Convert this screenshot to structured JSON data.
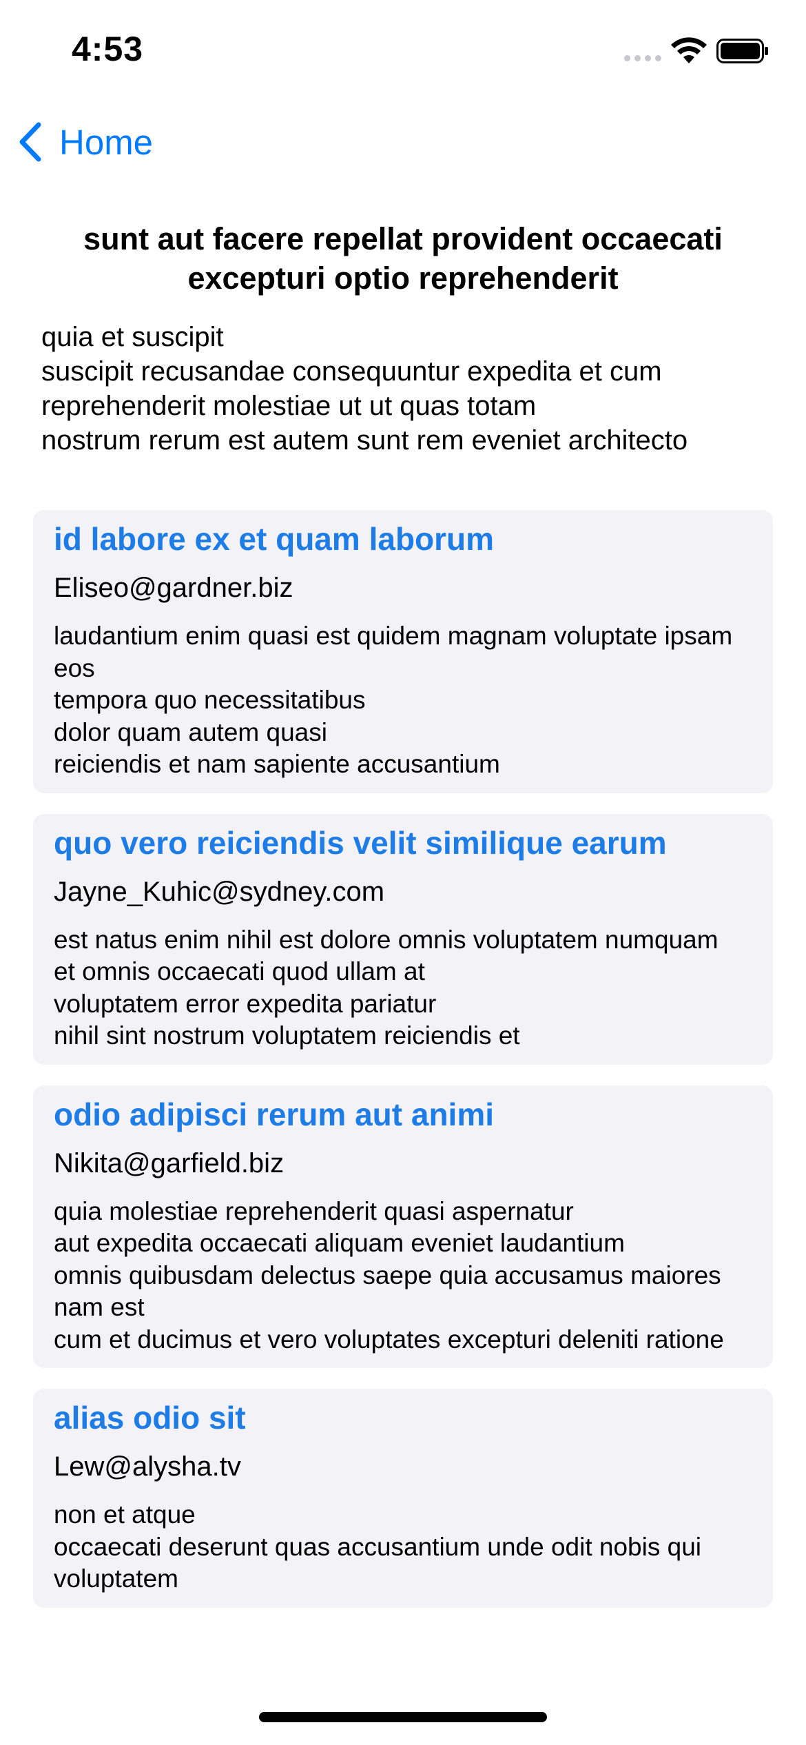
{
  "status_bar": {
    "time": "4:53"
  },
  "nav": {
    "back_label": "Home"
  },
  "post": {
    "title": "sunt aut facere repellat provident occaecati excepturi optio reprehenderit",
    "body": "quia et suscipit\nsuscipit recusandae consequuntur expedita et cum\nreprehenderit molestiae ut ut quas totam\nnostrum rerum est autem sunt rem eveniet architecto"
  },
  "comments": [
    {
      "name": "id labore ex et quam laborum",
      "email": "Eliseo@gardner.biz",
      "body": "laudantium enim quasi est quidem magnam voluptate ipsam eos\ntempora quo necessitatibus\ndolor quam autem quasi\nreiciendis et nam sapiente accusantium"
    },
    {
      "name": "quo vero reiciendis velit similique earum",
      "email": "Jayne_Kuhic@sydney.com",
      "body": "est natus enim nihil est dolore omnis voluptatem numquam\net omnis occaecati quod ullam at\nvoluptatem error expedita pariatur\nnihil sint nostrum voluptatem reiciendis et"
    },
    {
      "name": "odio adipisci rerum aut animi",
      "email": "Nikita@garfield.biz",
      "body": "quia molestiae reprehenderit quasi aspernatur\naut expedita occaecati aliquam eveniet laudantium\nomnis quibusdam delectus saepe quia accusamus maiores nam est\ncum et ducimus et vero voluptates excepturi deleniti ratione"
    },
    {
      "name": "alias odio sit",
      "email": "Lew@alysha.tv",
      "body": "non et atque\noccaecati deserunt quas accusantium unde odit nobis qui voluptatem"
    }
  ]
}
